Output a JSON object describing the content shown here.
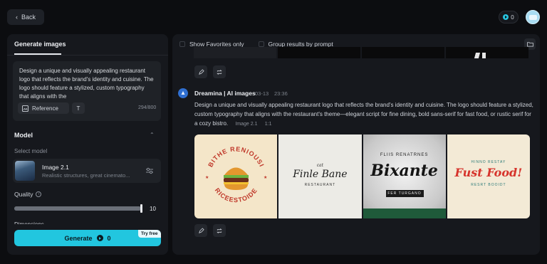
{
  "header": {
    "back_label": "Back",
    "credits": "0"
  },
  "left_panel": {
    "tab_label": "Generate images",
    "prompt_text": "Design a unique and visually appealing restaurant logo that reflects the brand's identity and cuisine. The logo should feature a stylized, custom typography that aligns with the",
    "reference_label": "Reference",
    "text_button_label": "T",
    "char_counter": "294/800",
    "model_heading": "Model",
    "select_model_label": "Select model",
    "model_name": "Image 2.1",
    "model_description": "Realistic structures, great cinemato...",
    "quality_label": "Quality",
    "quality_value": "10",
    "quality_fraction": 1.0,
    "dimensions_label": "Dimensions",
    "generate_label": "Generate",
    "generate_cost": "0",
    "try_free_label": "Try free"
  },
  "right_panel": {
    "show_favorites_label": "Show Favorites only",
    "group_results_label": "Group results by prompt",
    "result": {
      "author": "Dreamina | AI images",
      "date": "03-13",
      "time": "23:36",
      "description": "Design a unique and visually appealing restaurant logo that reflects the brand's identity and cuisine. The logo should feature a stylized, custom typography that aligns with the restaurant's theme—elegant script for fine dining, bold sans-serif for fast food, or rustic serif for a cozy bistro.",
      "model_tag": "Image 2.1",
      "ratio_tag": "1:1",
      "images": [
        {
          "top_text": "BITHE RENIOUSI",
          "bottom_text": "RICEESTOIDE"
        },
        {
          "small_top": "cat",
          "main": "Finle Bane",
          "sub": "RESTAURANT"
        },
        {
          "top_text": "FLIIS RENATRNES",
          "main": "Bixante",
          "sub": "FER TURGANO"
        },
        {
          "small_top": "HINNO RESTAY",
          "main": "Fust Food!",
          "sub": "RESRT BOOIDT"
        }
      ]
    }
  },
  "colors": {
    "accent": "#22c6df",
    "panel": "#16181d",
    "background": "#0c0d10"
  }
}
